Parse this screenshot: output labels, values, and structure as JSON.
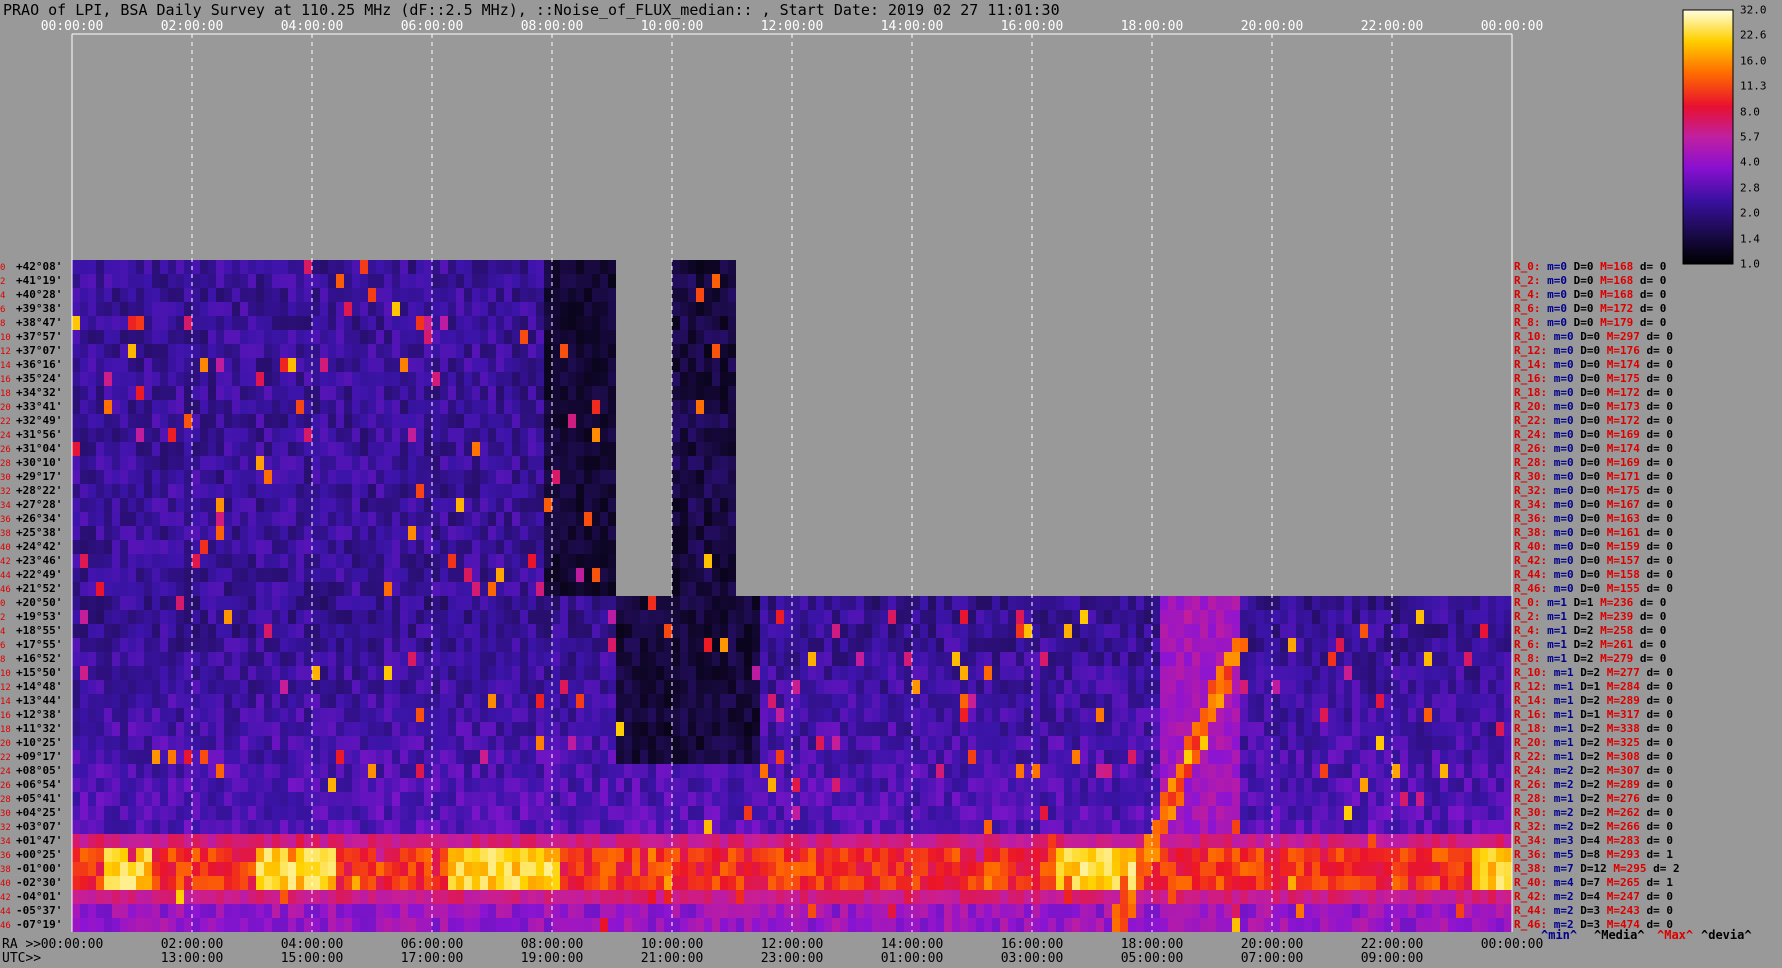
{
  "title": "PRAO of LPI, BSA Daily Survey at 110.25 MHz (dF::2.5 MHz), ::Noise_of_FLUX_median:: , Start Date: 2019 02 27 11:01:30",
  "ra_axis_label": "RA >>",
  "utc_axis_label": "UTC>>",
  "chart_data": {
    "type": "heatmap",
    "top_ticks": [
      "00:00:00",
      "02:00:00",
      "04:00:00",
      "06:00:00",
      "08:00:00",
      "10:00:00",
      "12:00:00",
      "14:00:00",
      "16:00:00",
      "18:00:00",
      "20:00:00",
      "22:00:00",
      "00:00:00"
    ],
    "bottom_ticks_ra": [
      "00:00:00",
      "02:00:00",
      "04:00:00",
      "06:00:00",
      "08:00:00",
      "10:00:00",
      "12:00:00",
      "14:00:00",
      "16:00:00",
      "18:00:00",
      "20:00:00",
      "22:00:00",
      "00:00:00"
    ],
    "bottom_ticks_utc": [
      "13:00:00",
      "15:00:00",
      "17:00:00",
      "19:00:00",
      "21:00:00",
      "23:00:00",
      "01:00:00",
      "03:00:00",
      "05:00:00",
      "07:00:00",
      "09:00:00"
    ],
    "declinations": [
      "+42°08'",
      "+41°19'",
      "+40°28'",
      "+39°38'",
      "+38°47'",
      "+37°57'",
      "+37°07'",
      "+36°16'",
      "+35°24'",
      "+34°32'",
      "+33°41'",
      "+32°49'",
      "+31°56'",
      "+31°04'",
      "+30°10'",
      "+29°17'",
      "+28°22'",
      "+27°28'",
      "+26°34'",
      "+25°38'",
      "+24°42'",
      "+23°46'",
      "+22°49'",
      "+21°52'",
      "+20°50'",
      "+19°53'",
      "+18°55'",
      "+17°55'",
      "+16°52'",
      "+15°50'",
      "+14°48'",
      "+13°44'",
      "+12°38'",
      "+11°32'",
      "+10°25'",
      "+09°17'",
      "+08°05'",
      "+06°54'",
      "+05°41'",
      "+04°25'",
      "+03°07'",
      "+01°47'",
      "+00°25'",
      "-01°00'",
      "-02°30'",
      "-04°01'",
      "-05°37'",
      "-07°19'"
    ],
    "row_indices": [
      "0",
      "2",
      "4",
      "6",
      "8",
      "10",
      "12",
      "14",
      "16",
      "18",
      "20",
      "22",
      "24",
      "26",
      "28",
      "30",
      "32",
      "34",
      "36",
      "38",
      "40",
      "42",
      "44",
      "46",
      "0",
      "2",
      "4",
      "6",
      "8",
      "10",
      "12",
      "14",
      "16",
      "18",
      "20",
      "22",
      "24",
      "26",
      "28",
      "30",
      "32",
      "34",
      "36",
      "38",
      "40",
      "42",
      "44",
      "46"
    ],
    "stats": [
      {
        "r": "R_0:",
        "m": "m=0",
        "D": "D=0",
        "M": "M=168",
        "d": "d= 0"
      },
      {
        "r": "R_2:",
        "m": "m=0",
        "D": "D=0",
        "M": "M=168",
        "d": "d= 0"
      },
      {
        "r": "R_4:",
        "m": "m=0",
        "D": "D=0",
        "M": "M=168",
        "d": "d= 0"
      },
      {
        "r": "R_6:",
        "m": "m=0",
        "D": "D=0",
        "M": "M=172",
        "d": "d= 0"
      },
      {
        "r": "R_8:",
        "m": "m=0",
        "D": "D=0",
        "M": "M=179",
        "d": "d= 0"
      },
      {
        "r": "R_10:",
        "m": "m=0",
        "D": "D=0",
        "M": "M=297",
        "d": "d= 0"
      },
      {
        "r": "R_12:",
        "m": "m=0",
        "D": "D=0",
        "M": "M=176",
        "d": "d= 0"
      },
      {
        "r": "R_14:",
        "m": "m=0",
        "D": "D=0",
        "M": "M=174",
        "d": "d= 0"
      },
      {
        "r": "R_16:",
        "m": "m=0",
        "D": "D=0",
        "M": "M=175",
        "d": "d= 0"
      },
      {
        "r": "R_18:",
        "m": "m=0",
        "D": "D=0",
        "M": "M=172",
        "d": "d= 0"
      },
      {
        "r": "R_20:",
        "m": "m=0",
        "D": "D=0",
        "M": "M=173",
        "d": "d= 0"
      },
      {
        "r": "R_22:",
        "m": "m=0",
        "D": "D=0",
        "M": "M=172",
        "d": "d= 0"
      },
      {
        "r": "R_24:",
        "m": "m=0",
        "D": "D=0",
        "M": "M=169",
        "d": "d= 0"
      },
      {
        "r": "R_26:",
        "m": "m=0",
        "D": "D=0",
        "M": "M=174",
        "d": "d= 0"
      },
      {
        "r": "R_28:",
        "m": "m=0",
        "D": "D=0",
        "M": "M=169",
        "d": "d= 0"
      },
      {
        "r": "R_30:",
        "m": "m=0",
        "D": "D=0",
        "M": "M=171",
        "d": "d= 0"
      },
      {
        "r": "R_32:",
        "m": "m=0",
        "D": "D=0",
        "M": "M=175",
        "d": "d= 0"
      },
      {
        "r": "R_34:",
        "m": "m=0",
        "D": "D=0",
        "M": "M=167",
        "d": "d= 0"
      },
      {
        "r": "R_36:",
        "m": "m=0",
        "D": "D=0",
        "M": "M=163",
        "d": "d= 0"
      },
      {
        "r": "R_38:",
        "m": "m=0",
        "D": "D=0",
        "M": "M=161",
        "d": "d= 0"
      },
      {
        "r": "R_40:",
        "m": "m=0",
        "D": "D=0",
        "M": "M=159",
        "d": "d= 0"
      },
      {
        "r": "R_42:",
        "m": "m=0",
        "D": "D=0",
        "M": "M=157",
        "d": "d= 0"
      },
      {
        "r": "R_44:",
        "m": "m=0",
        "D": "D=0",
        "M": "M=158",
        "d": "d= 0"
      },
      {
        "r": "R_46:",
        "m": "m=0",
        "D": "D=0",
        "M": "M=155",
        "d": "d= 0"
      },
      {
        "r": "R_0:",
        "m": "m=1",
        "D": "D=1",
        "M": "M=236",
        "d": "d= 0"
      },
      {
        "r": "R_2:",
        "m": "m=1",
        "D": "D=2",
        "M": "M=239",
        "d": "d= 0"
      },
      {
        "r": "R_4:",
        "m": "m=1",
        "D": "D=2",
        "M": "M=258",
        "d": "d= 0"
      },
      {
        "r": "R_6:",
        "m": "m=1",
        "D": "D=2",
        "M": "M=261",
        "d": "d= 0"
      },
      {
        "r": "R_8:",
        "m": "m=1",
        "D": "D=2",
        "M": "M=279",
        "d": "d= 0"
      },
      {
        "r": "R_10:",
        "m": "m=1",
        "D": "D=2",
        "M": "M=277",
        "d": "d= 0"
      },
      {
        "r": "R_12:",
        "m": "m=1",
        "D": "D=1",
        "M": "M=284",
        "d": "d= 0"
      },
      {
        "r": "R_14:",
        "m": "m=1",
        "D": "D=2",
        "M": "M=289",
        "d": "d= 0"
      },
      {
        "r": "R_16:",
        "m": "m=1",
        "D": "D=1",
        "M": "M=317",
        "d": "d= 0"
      },
      {
        "r": "R_18:",
        "m": "m=1",
        "D": "D=2",
        "M": "M=338",
        "d": "d= 0"
      },
      {
        "r": "R_20:",
        "m": "m=1",
        "D": "D=2",
        "M": "M=325",
        "d": "d= 0"
      },
      {
        "r": "R_22:",
        "m": "m=1",
        "D": "D=2",
        "M": "M=308",
        "d": "d= 0"
      },
      {
        "r": "R_24:",
        "m": "m=2",
        "D": "D=2",
        "M": "M=307",
        "d": "d= 0"
      },
      {
        "r": "R_26:",
        "m": "m=2",
        "D": "D=2",
        "M": "M=289",
        "d": "d= 0"
      },
      {
        "r": "R_28:",
        "m": "m=1",
        "D": "D=2",
        "M": "M=276",
        "d": "d= 0"
      },
      {
        "r": "R_30:",
        "m": "m=2",
        "D": "D=2",
        "M": "M=262",
        "d": "d= 0"
      },
      {
        "r": "R_32:",
        "m": "m=2",
        "D": "D=2",
        "M": "M=266",
        "d": "d= 0"
      },
      {
        "r": "R_34:",
        "m": "m=3",
        "D": "D=4",
        "M": "M=283",
        "d": "d= 0"
      },
      {
        "r": "R_36:",
        "m": "m=5",
        "D": "D=8",
        "M": "M=293",
        "d": "d= 1"
      },
      {
        "r": "R_38:",
        "m": "m=7",
        "D": "D=12",
        "M": "M=295",
        "d": "d= 2"
      },
      {
        "r": "R_40:",
        "m": "m=4",
        "D": "D=7",
        "M": "M=265",
        "d": "d= 1"
      },
      {
        "r": "R_42:",
        "m": "m=2",
        "D": "D=4",
        "M": "M=247",
        "d": "d= 0"
      },
      {
        "r": "R_44:",
        "m": "m=2",
        "D": "D=3",
        "M": "M=243",
        "d": "d= 0"
      },
      {
        "r": "R_46:",
        "m": "m=2",
        "D": "D=3",
        "M": "M=474",
        "d": "d= 0"
      }
    ],
    "legend": {
      "min": "^min^",
      "media": "^Media^",
      "max": "^Max^",
      "devia": "^devia^"
    },
    "colorbar_ticks": [
      "32.0",
      "22.6",
      "16.0",
      "11.3",
      "8.0",
      "5.7",
      "4.0",
      "2.8",
      "2.0",
      "1.4",
      "1.0"
    ],
    "colors": {
      "background": "#999999",
      "max_label": "#dd0000",
      "min_label": "#00008b"
    }
  }
}
